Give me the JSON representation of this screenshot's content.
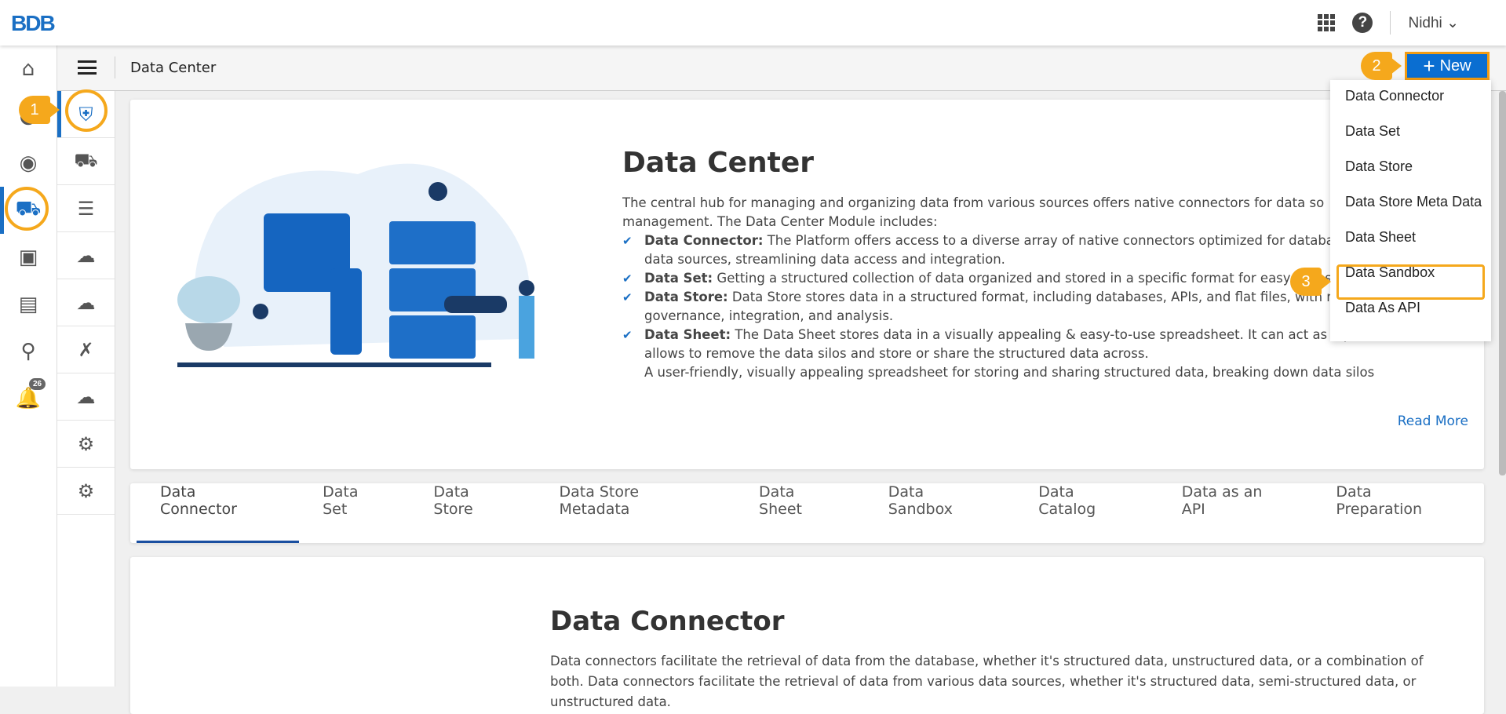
{
  "app": {
    "logo": "BDB",
    "user": "Nidhi"
  },
  "subheader": {
    "breadcrumb": "Data Center",
    "new_label": "New"
  },
  "callouts": [
    "1",
    "2",
    "3"
  ],
  "leftbar": {
    "notification_count": "26"
  },
  "dropdown": [
    "Data Connector",
    "Data Set",
    "Data Store",
    "Data Store Meta Data",
    "Data Sheet",
    "Data Sandbox",
    "Data As API"
  ],
  "hero": {
    "title": "Data Center",
    "intro1": "The central hub for managing and organizing data from various sources offers native connectors for data so",
    "intro2": "management. The Data Center Module includes:",
    "items": [
      {
        "term": "Data Connector:",
        "text": " The Platform offers access to a diverse array of native connectors optimized for databases, file",
        "cont": "data sources, streamlining data access and integration."
      },
      {
        "term": "Data Set:",
        "text": " Getting a structured collection of data organized and stored in a specific format for easy access, retriev",
        "cont": ""
      },
      {
        "term": "Data Store:",
        "text": " Data Store stores data in a structured format, including databases, APIs, and flat files, with m",
        "cont": "governance, integration, and analysis."
      },
      {
        "term": "Data Sheet:",
        "text": " The Data Sheet stores data in a visually appealing & easy-to-use spreadsheet. It can act as a powerful database that",
        "cont": "allows to remove the data silos and store or share the structured data across."
      }
    ],
    "extra": "A user-friendly, visually appealing spreadsheet for storing and sharing structured data, breaking down data silos",
    "read_more": "Read More"
  },
  "tabs": [
    "Data Connector",
    "Data Set",
    "Data Store",
    "Data Store Metadata",
    "Data Sheet",
    "Data Sandbox",
    "Data Catalog",
    "Data as an API",
    "Data Preparation"
  ],
  "lower": {
    "title": "Data Connector",
    "text": "Data connectors facilitate the retrieval of data from the database, whether it's structured data, unstructured data, or a combination of both. Data connectors facilitate the retrieval of data from various data sources, whether it's structured data, semi-structured data, or unstructured data."
  }
}
